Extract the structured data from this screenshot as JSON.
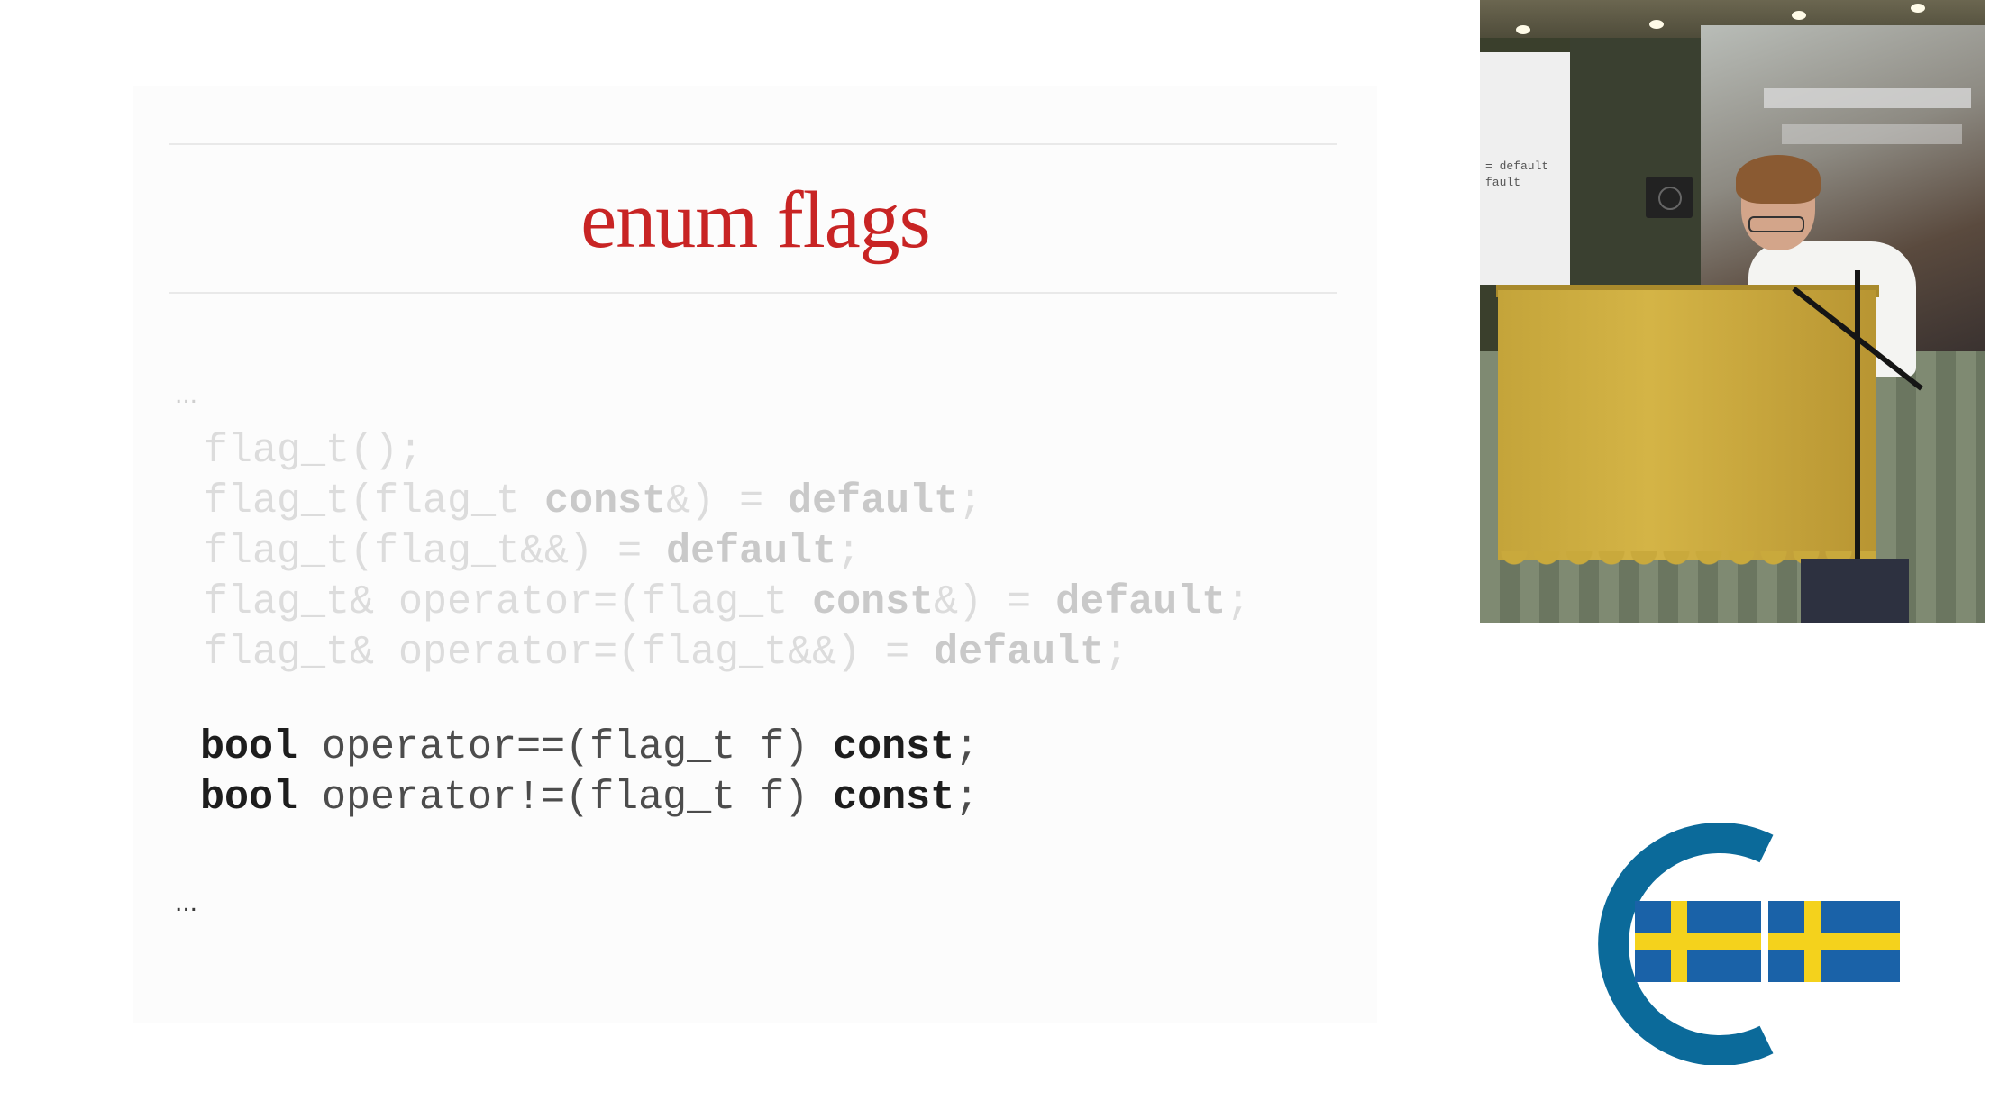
{
  "slide": {
    "title": "enum flags",
    "ellipsis_top": "...",
    "ellipsis_bottom": "...",
    "dim_lines": [
      {
        "pre": "flag_t();",
        "kw": "",
        "post": ""
      },
      {
        "pre": "flag_t(flag_t ",
        "kw": "const",
        "mid": "&) = ",
        "kw2": "default",
        "post": ";"
      },
      {
        "pre": "flag_t(flag_t&&) = ",
        "kw": "default",
        "post": ";"
      },
      {
        "pre": "flag_t& operator=(flag_t ",
        "kw": "const",
        "mid": "&) = ",
        "kw2": "default",
        "post": ";"
      },
      {
        "pre": "flag_t& operator=(flag_t&&) = ",
        "kw": "default",
        "post": ";"
      }
    ],
    "bright_lines": [
      {
        "kw": "bool",
        "mid": " operator==(flag_t f) ",
        "kw2": "const",
        "post": ";"
      },
      {
        "kw": "bool",
        "mid": " operator!=(flag_t f) ",
        "kw2": "const",
        "post": ";"
      }
    ]
  },
  "video": {
    "screen_text": "= default\nfault"
  },
  "logo": {
    "ring_color": "#0b6a9a",
    "flag_blue": "#1a62a8",
    "flag_yellow": "#f4d21c"
  },
  "colors": {
    "title": "#c82424",
    "code_dim": "#dcdcdc",
    "code_bright": "#1d1d1d"
  }
}
